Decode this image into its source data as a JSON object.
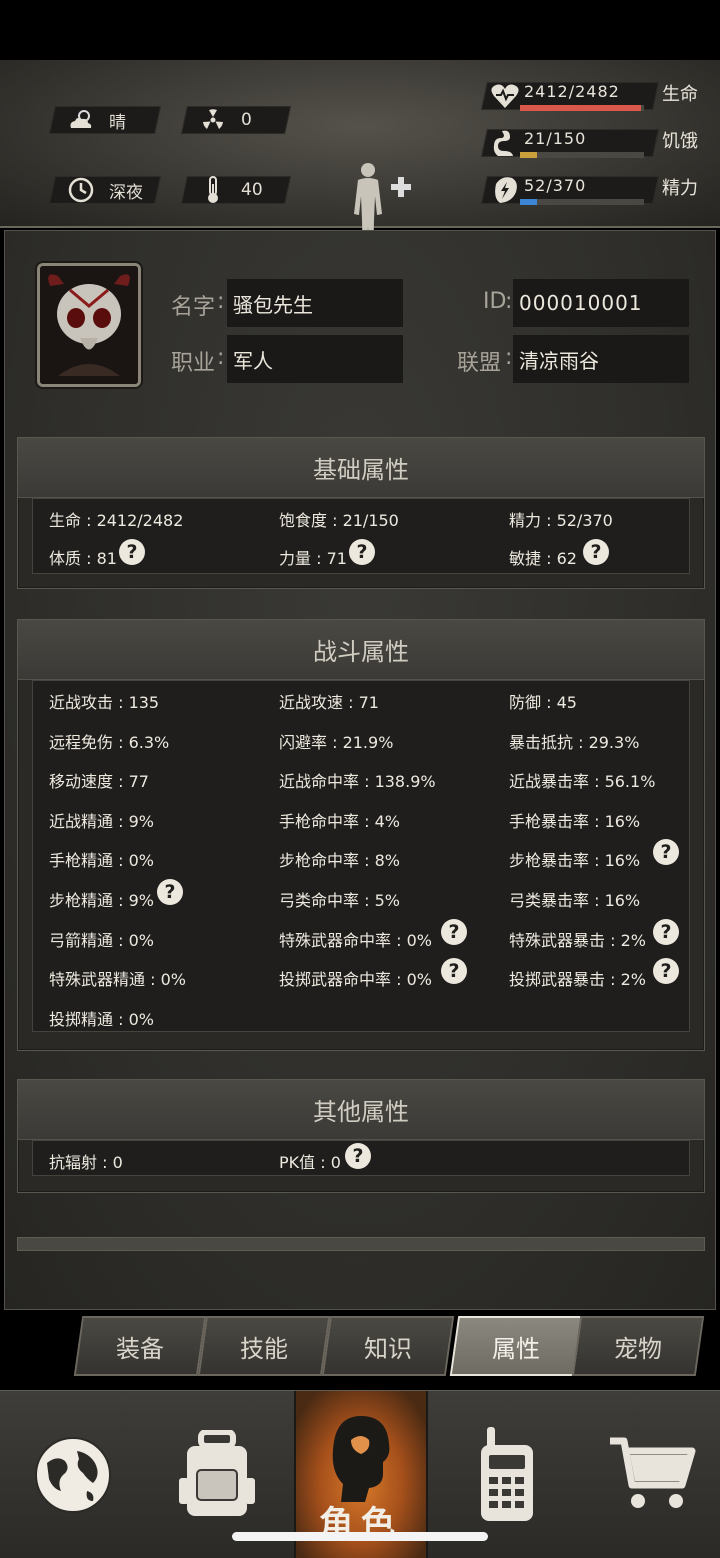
{
  "hud": {
    "weather": "晴",
    "radiation": "0",
    "time_of_day": "深夜",
    "temperature": "40",
    "stats": [
      {
        "name": "生命",
        "value": "2412/2482",
        "fraction": 0.972,
        "color": "#d9574b",
        "icon": "heart-icon"
      },
      {
        "name": "饥饿",
        "value": "21/150",
        "fraction": 0.14,
        "color": "#c9a03a",
        "icon": "stomach-icon"
      },
      {
        "name": "精力",
        "value": "52/370",
        "fraction": 0.14,
        "color": "#3d86d6",
        "icon": "energy-icon"
      }
    ]
  },
  "profile": {
    "name_label": "名字",
    "name_value": "骚包先生",
    "id_label": "ID",
    "id_value": "000010001",
    "job_label": "职业",
    "job_value": "军人",
    "alliance_label": "联盟",
    "alliance_value": "清凉雨谷"
  },
  "basic": {
    "title": "基础属性",
    "items": [
      "生命 : 2412/2482",
      "饱食度 : 21/150",
      "精力 : 52/370",
      "体质 : 81",
      "力量 : 71",
      "敏捷 : 62"
    ]
  },
  "combat": {
    "title": "战斗属性",
    "items": [
      "近战攻击 : 135",
      "近战攻速 : 71",
      "防御 : 45",
      "远程免伤 : 6.3%",
      "闪避率 : 21.9%",
      "暴击抵抗 : 29.3%",
      "移动速度 : 77",
      "近战命中率 : 138.9%",
      "近战暴击率 : 56.1%",
      "近战精通 : 9%",
      "手枪命中率 : 4%",
      "手枪暴击率 : 16%",
      "手枪精通 : 0%",
      "步枪命中率 : 8%",
      "步枪暴击率 : 16%",
      "步枪精通 : 9%",
      "弓类命中率 : 5%",
      "弓类暴击率 : 16%",
      "弓箭精通 : 0%",
      "特殊武器命中率 : 0%",
      "特殊武器暴击 : 2%",
      "特殊武器精通 : 0%",
      "投掷武器命中率 : 0%",
      "投掷武器暴击 : 2%",
      "投掷精通 : 0%"
    ]
  },
  "other": {
    "title": "其他属性",
    "items": [
      "抗辐射 : 0",
      "PK值 : 0"
    ]
  },
  "help_glyph": "?",
  "tabs": [
    "装备",
    "技能",
    "知识",
    "属性",
    "宠物"
  ],
  "active_tab": "属性",
  "nav": {
    "active_label": "角色"
  }
}
